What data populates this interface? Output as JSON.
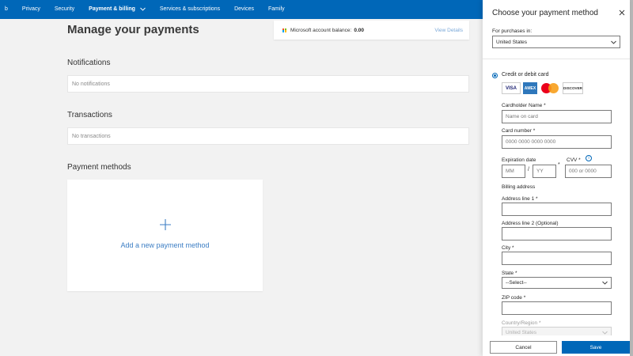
{
  "nav": {
    "items": [
      "b",
      "Privacy",
      "Security",
      "Payment & billing",
      "Services & subscriptions",
      "Devices",
      "Family"
    ]
  },
  "main": {
    "title": "Manage your payments",
    "balance": {
      "label": "Microsoft account balance:",
      "value": "0.00",
      "link": "View Details"
    },
    "notifications": {
      "title": "Notifications",
      "empty": "No notifications"
    },
    "transactions": {
      "title": "Transactions",
      "empty": "No transactions"
    },
    "payment_methods": {
      "title": "Payment methods",
      "add_label": "Add a new payment method"
    }
  },
  "panel": {
    "title": "Choose your payment method",
    "purchases_label": "For purchases in:",
    "purchases_value": "United States",
    "option_label": "Credit or debit card",
    "cards": [
      "VISA",
      "AMEX",
      "mastercard",
      "DISCOVER"
    ],
    "cardholder_label": "Cardholder Name *",
    "cardholder_placeholder": "Name on card",
    "card_number_label": "Card number *",
    "card_number_placeholder": "0000 0000 0000 0000",
    "expiration_label": "Expiration date",
    "exp_month_placeholder": "MM",
    "exp_year_placeholder": "YY",
    "exp_sep": "/",
    "exp_asterisk": "*",
    "cvv_label": "CVV *",
    "cvv_placeholder": "000 or 0000",
    "billing_label": "Billing address",
    "address1_label": "Address line 1 *",
    "address2_label": "Address line 2 (Optional)",
    "city_label": "City *",
    "state_label": "State *",
    "state_value": "--Select--",
    "zip_label": "ZIP code *",
    "country_label": "Country/Region *",
    "country_value": "United States",
    "cancel_label": "Cancel",
    "save_label": "Save"
  }
}
